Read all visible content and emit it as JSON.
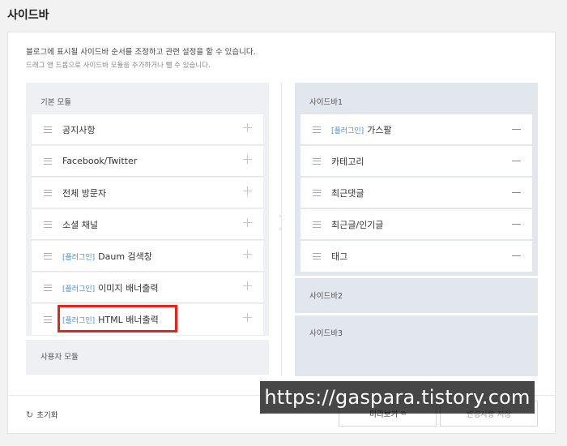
{
  "page": {
    "title": "사이드바"
  },
  "description": {
    "line1": "블로그에 표시될 사이드바 순서를 조정하고 관련 설정을 할 수 있습니다.",
    "line2": "드래그 앤 드롭으로 사이드바 모듈을 추가하거나 뺄 수 있습니다."
  },
  "left": {
    "basic_title": "기본 모듈",
    "user_title": "사용자 모듈",
    "items": [
      {
        "tag": "",
        "label": "공지사항"
      },
      {
        "tag": "",
        "label": "Facebook/Twitter"
      },
      {
        "tag": "",
        "label": "전체 방문자"
      },
      {
        "tag": "",
        "label": "소셜 채널"
      },
      {
        "tag": "[플러그인]",
        "label": "Daum 검색창"
      },
      {
        "tag": "[플러그인]",
        "label": "이미지 배너출력"
      },
      {
        "tag": "[플러그인]",
        "label": "HTML 배너출력"
      }
    ]
  },
  "right": {
    "sidebar1_title": "사이드바1",
    "sidebar2_title": "사이드바2",
    "sidebar3_title": "사이드바3",
    "items": [
      {
        "tag": "[플러그인]",
        "label": "가스팔"
      },
      {
        "tag": "",
        "label": "카테고리"
      },
      {
        "tag": "",
        "label": "최근댓글"
      },
      {
        "tag": "",
        "label": "최근글/인기글"
      },
      {
        "tag": "",
        "label": "태그"
      }
    ]
  },
  "footer": {
    "reset_label": "초기화",
    "preview_label": "미리보기",
    "save_label": "변경사항 저장"
  },
  "watermark": {
    "text": "https://gaspara.tistory.com"
  },
  "colors": {
    "highlight": "#e8221b",
    "plugin_tag": "#4a90d9"
  }
}
